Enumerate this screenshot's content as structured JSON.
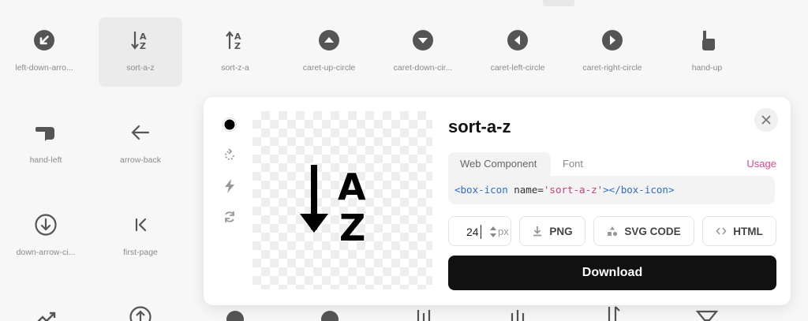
{
  "grid": {
    "row1": [
      "left-down-arro...",
      "sort-a-z",
      "sort-z-a",
      "caret-up-circle",
      "caret-down-cir...",
      "caret-left-circle",
      "caret-right-circle",
      "hand-up"
    ],
    "row2": [
      "hand-left",
      "arrow-back"
    ],
    "row3": [
      "down-arrow-ci...",
      "first-page"
    ],
    "selected": "sort-a-z"
  },
  "panel": {
    "title": "sort-a-z",
    "tabs": [
      "Web Component",
      "Font"
    ],
    "active_tab": "Web Component",
    "usage_label": "Usage",
    "code": {
      "open_tag": "<box-icon",
      "attr": " name=",
      "value": "'sort-a-z'",
      "close": "></box-icon>"
    },
    "size_value": "24",
    "size_unit": "px",
    "png_label": "PNG",
    "svg_label": "SVG CODE",
    "html_label": "HTML",
    "download_label": "Download"
  },
  "colors": {
    "accent_usage": "#e0468a",
    "code_tag": "#2a6dc5",
    "code_string": "#c4407a",
    "download_bg": "#111111"
  }
}
